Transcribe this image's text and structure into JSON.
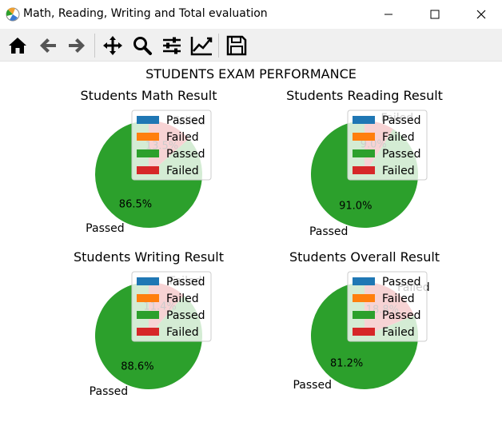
{
  "window": {
    "title": "Math, Reading, Writing and Total evaluation"
  },
  "toolbar": {
    "icons": [
      "home-icon",
      "back-icon",
      "forward-icon",
      "pan-icon",
      "zoom-icon",
      "configure-subplots-icon",
      "edit-axis-icon",
      "save-icon"
    ]
  },
  "figure": {
    "suptitle": "STUDENTS EXAM PERFORMANCE"
  },
  "colors": {
    "blue": "#1f77b4",
    "orange": "#ff7f0e",
    "green": "#2ca02c",
    "red": "#d62728"
  },
  "chart_data": [
    {
      "type": "pie",
      "title": "Students Math Result",
      "labels": [
        "Passed",
        "Failed"
      ],
      "values": [
        86.5,
        13.5
      ],
      "autopct": [
        "86.5%",
        "13.5%"
      ],
      "legend": [
        "Passed",
        "Failed",
        "Passed",
        "Failed"
      ],
      "legend_loc": "upper-right"
    },
    {
      "type": "pie",
      "title": "Students Reading Result",
      "labels": [
        "Passed",
        "Failed"
      ],
      "values": [
        91.0,
        9.0
      ],
      "autopct": [
        "91.0%",
        "9.0%"
      ],
      "legend": [
        "Passed",
        "Failed",
        "Passed",
        "Failed"
      ],
      "legend_loc": "upper-right"
    },
    {
      "type": "pie",
      "title": "Students Writing Result",
      "labels": [
        "Passed",
        "Failed"
      ],
      "values": [
        88.6,
        11.4
      ],
      "autopct": [
        "88.6%",
        "11.4%"
      ],
      "legend": [
        "Passed",
        "Failed",
        "Passed",
        "Failed"
      ],
      "legend_loc": "upper-right"
    },
    {
      "type": "pie",
      "title": "Students Overall Result",
      "labels": [
        "Passed",
        "Failed"
      ],
      "values": [
        81.2,
        18.8
      ],
      "autopct": [
        "81.2%",
        "18.8%"
      ],
      "legend": [
        "Passed",
        "Failed",
        "Passed",
        "Failed"
      ],
      "legend_loc": "upper-right"
    }
  ]
}
